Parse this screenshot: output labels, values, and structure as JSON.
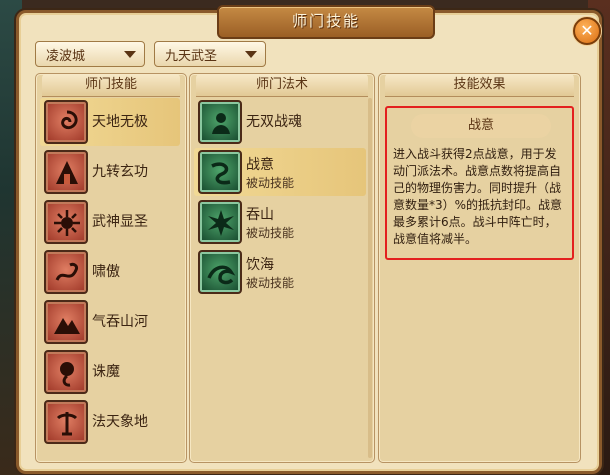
{
  "window": {
    "title": "师门技能",
    "close_icon": "✕"
  },
  "dropdowns": [
    {
      "label": "凌波城"
    },
    {
      "label": "九天武圣"
    }
  ],
  "panels": {
    "sect_skills": {
      "header": "师门技能",
      "items": [
        {
          "name": "天地无极",
          "icon": "swirl-icon"
        },
        {
          "name": "九转玄功",
          "icon": "pagoda-icon"
        },
        {
          "name": "武神显圣",
          "icon": "sunburst-icon"
        },
        {
          "name": "啸傲",
          "icon": "dragon-icon"
        },
        {
          "name": "气吞山河",
          "icon": "mountain-icon"
        },
        {
          "name": "诛魔",
          "icon": "demon-icon"
        },
        {
          "name": "法天象地",
          "icon": "giant-icon"
        }
      ]
    },
    "sect_spells": {
      "header": "师门法术",
      "items": [
        {
          "name": "无双战魂",
          "sub": "",
          "icon": "warrior-spirit-icon"
        },
        {
          "name": "战意",
          "sub": "被动技能",
          "icon": "battle-will-icon"
        },
        {
          "name": "吞山",
          "sub": "被动技能",
          "icon": "spiky-burst-icon"
        },
        {
          "name": "饮海",
          "sub": "被动技能",
          "icon": "wave-icon"
        }
      ]
    },
    "skill_effect": {
      "header": "技能效果",
      "title": "战意",
      "description": "进入战斗获得2点战意，用于发动门派法术。战意点数将提高自己的物理伤害力。同时提升（战意数量*3）%的抵抗封印。战意最多累计6点。战斗中阵亡时，战意值将减半。"
    }
  }
}
